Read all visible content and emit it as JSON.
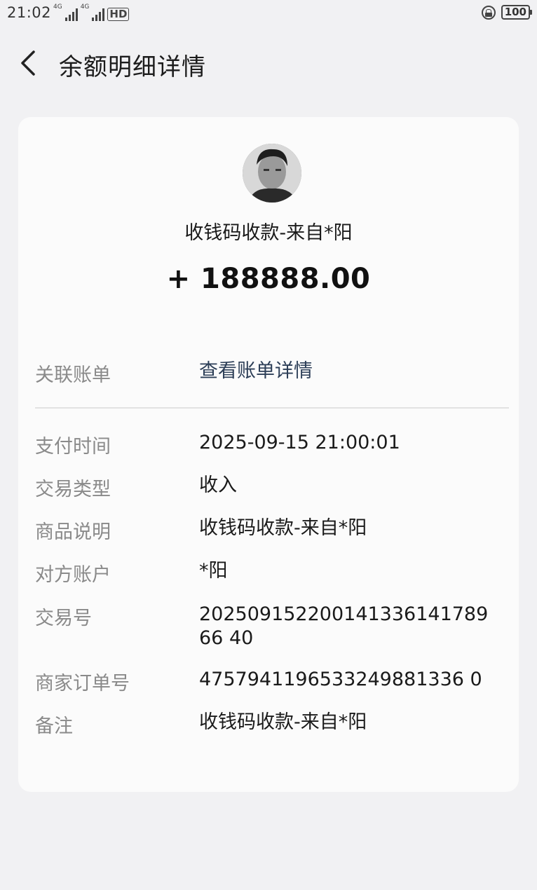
{
  "status_bar": {
    "time": "21:02",
    "net1": "4G",
    "net2": "4G",
    "hd": "HD",
    "battery": "100"
  },
  "nav": {
    "title": "余额明细详情"
  },
  "card": {
    "payer_title": "收钱码收款-来自*阳",
    "amount": "+ 188888.00",
    "related_bill": {
      "label": "关联账单",
      "value": "查看账单详情"
    },
    "details": [
      {
        "label": "支付时间",
        "value": "2025-09-15 21:00:01"
      },
      {
        "label": "交易类型",
        "value": "收入"
      },
      {
        "label": "商品说明",
        "value": "收钱码收款-来自*阳"
      },
      {
        "label": "对方账户",
        "value": "*阳"
      },
      {
        "label": "交易号",
        "value": "20250915220014133614178966 40"
      },
      {
        "label": "商家订单号",
        "value": "4757941196533249881336 0"
      },
      {
        "label": "备注",
        "value": "收钱码收款-来自*阳"
      }
    ]
  }
}
